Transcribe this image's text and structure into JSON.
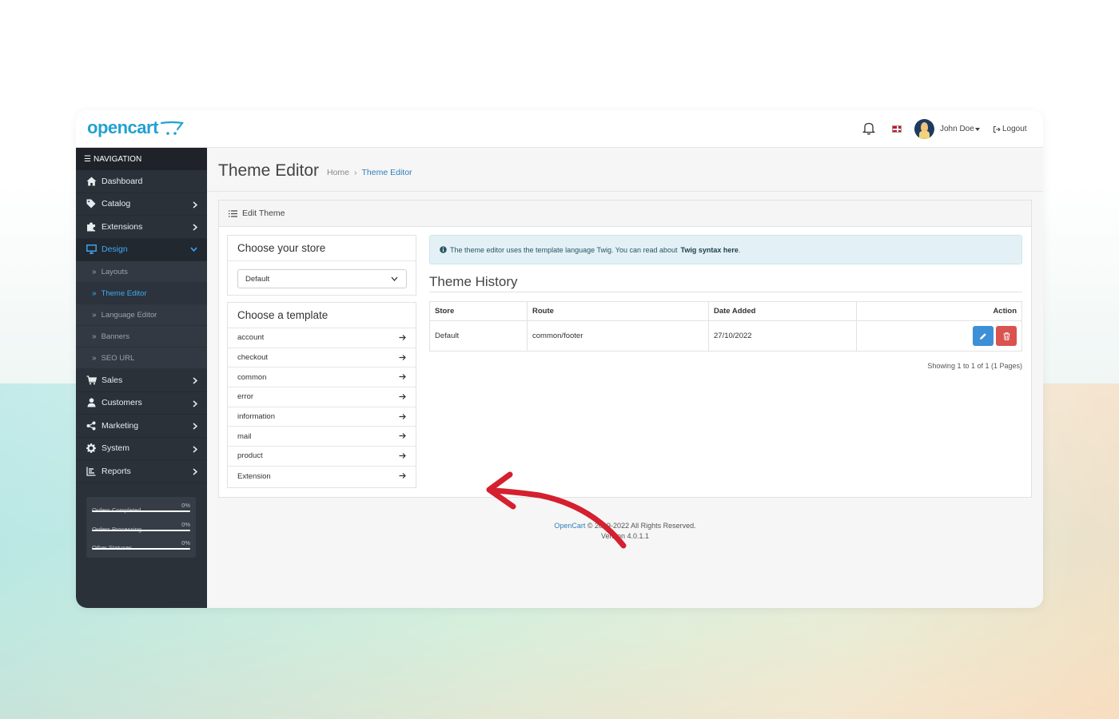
{
  "app": {
    "logo_text": "opencart",
    "accent": "#23a1d1"
  },
  "topbar": {
    "user_name": "John Doe",
    "logout_label": "Logout"
  },
  "sidebar": {
    "header": "NAVIGATION",
    "items": [
      {
        "label": "Dashboard",
        "icon": "home-icon"
      },
      {
        "label": "Catalog",
        "icon": "tag-icon"
      },
      {
        "label": "Extensions",
        "icon": "puzzle-icon"
      },
      {
        "label": "Design",
        "icon": "monitor-icon"
      },
      {
        "label": "Sales",
        "icon": "cart-icon"
      },
      {
        "label": "Customers",
        "icon": "user-icon"
      },
      {
        "label": "Marketing",
        "icon": "share-icon"
      },
      {
        "label": "System",
        "icon": "gear-icon"
      },
      {
        "label": "Reports",
        "icon": "bar-chart-icon"
      }
    ],
    "design_sub": [
      {
        "label": "Layouts"
      },
      {
        "label": "Theme Editor"
      },
      {
        "label": "Language Editor"
      },
      {
        "label": "Banners"
      },
      {
        "label": "SEO URL"
      }
    ],
    "stats": [
      {
        "label": "Orders Completed",
        "value": "0%",
        "progress": 0
      },
      {
        "label": "Orders Processing",
        "value": "0%",
        "progress": 0
      },
      {
        "label": "Other Statuses",
        "value": "0%",
        "progress": 0
      }
    ]
  },
  "page": {
    "title": "Theme Editor",
    "breadcrumb": [
      "Home",
      "Theme Editor"
    ]
  },
  "card": {
    "title": "Edit Theme",
    "store_box_title": "Choose your store",
    "store_selected": "Default",
    "template_box_title": "Choose a template",
    "templates": [
      "account",
      "checkout",
      "common",
      "error",
      "information",
      "mail",
      "product",
      "Extension"
    ]
  },
  "alert": {
    "text": "The theme editor uses the template language Twig. You can read about",
    "link": "Twig syntax here",
    "end": "."
  },
  "history": {
    "title": "Theme History",
    "columns": [
      "Store",
      "Route",
      "Date Added",
      "Action"
    ],
    "rows": [
      {
        "store": "Default",
        "route": "common/footer",
        "date": "27/10/2022"
      }
    ],
    "showing": "Showing 1 to 1 of 1 (1 Pages)"
  },
  "footer": {
    "brand": "OpenCart",
    "copyright": "© 2009-2022 All Rights Reserved.",
    "version": "Version 4.0.1.1"
  },
  "annotation": {
    "arrow_color": "#d4202f"
  }
}
